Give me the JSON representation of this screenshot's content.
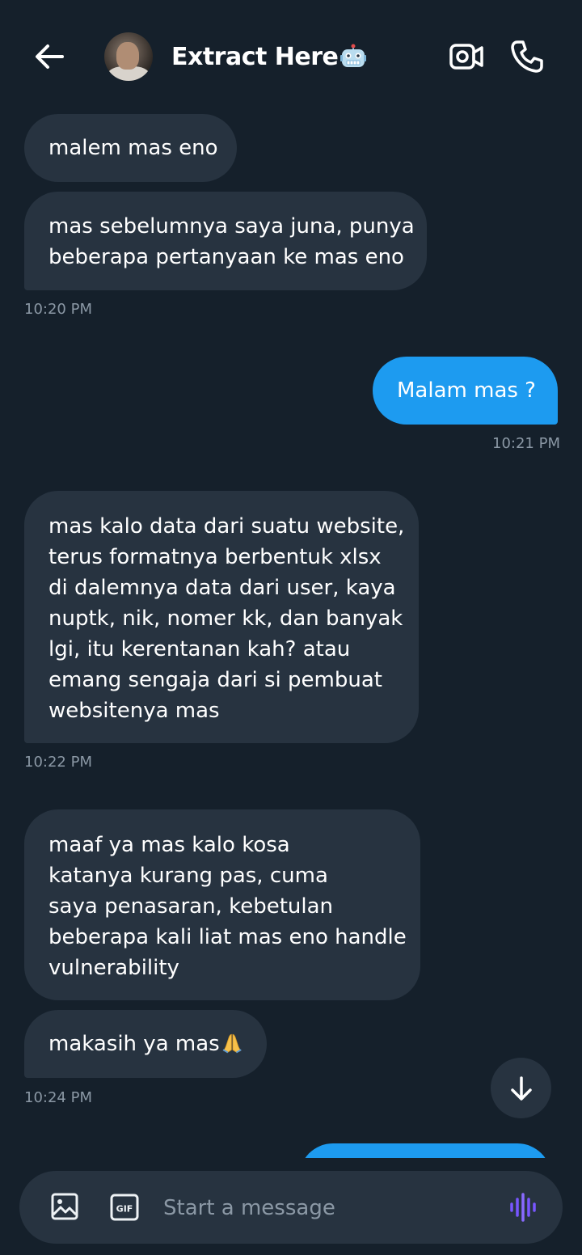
{
  "header": {
    "title": "Extract Here",
    "title_emoji": "robot-emoji",
    "icons": {
      "back": "back-arrow-icon",
      "video": "video-call-icon",
      "call": "phone-icon"
    }
  },
  "messages": [
    {
      "direction": "incoming",
      "lines": [
        "malem mas eno"
      ]
    },
    {
      "direction": "incoming",
      "lines": [
        "mas sebelumnya saya juna, punya",
        "beberapa pertanyaan ke mas eno"
      ],
      "timestamp": "10:20 PM"
    },
    {
      "direction": "outgoing",
      "lines": [
        "Malam mas ?"
      ],
      "timestamp": "10:21 PM"
    },
    {
      "direction": "incoming",
      "lines": [
        "mas kalo data dari suatu website,",
        "terus formatnya berbentuk xlsx",
        "di dalemnya data dari user, kaya",
        "nuptk, nik, nomer kk, dan banyak",
        "lgi, itu kerentanan kah? atau",
        "emang sengaja dari si pembuat",
        "websitenya mas"
      ],
      "timestamp": "10:22 PM"
    },
    {
      "direction": "incoming",
      "lines": [
        "maaf ya mas kalo kosa",
        "katanya kurang pas, cuma",
        "saya penasaran, kebetulan",
        "beberapa kali liat mas eno handle",
        "vulnerability"
      ]
    },
    {
      "direction": "incoming",
      "lines": [
        "makasih ya mas"
      ],
      "emoji": "folded-hands-emoji",
      "timestamp": "10:24 PM"
    }
  ],
  "composer": {
    "placeholder": "Start a message",
    "icons": {
      "image": "image-icon",
      "gif": "gif-icon",
      "gif_text": "GIF",
      "voice": "voice-waveform-icon"
    }
  },
  "scroll_down": {
    "icon": "arrow-down-icon"
  },
  "colors": {
    "background": "#15202b",
    "incoming_bubble": "#273340",
    "outgoing_bubble": "#1d9bf0",
    "timestamp": "#8b98a5",
    "voice_accent": "#7856ff"
  }
}
